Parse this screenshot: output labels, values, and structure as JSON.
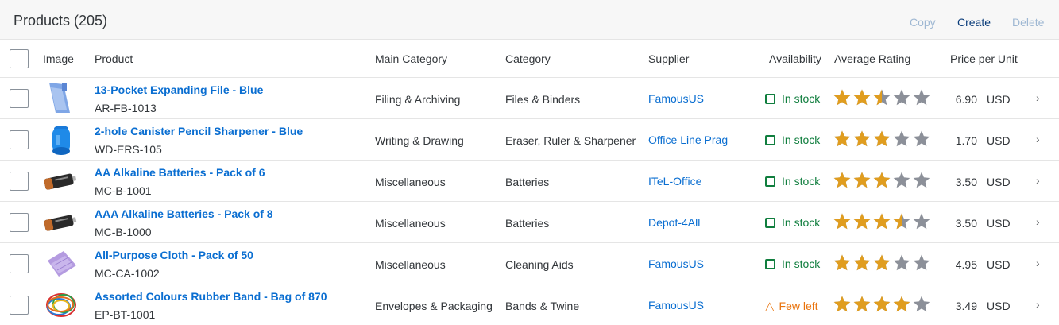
{
  "toolbar": {
    "title": "Products (205)",
    "copy_label": "Copy",
    "create_label": "Create",
    "delete_label": "Delete"
  },
  "columns": {
    "image": "Image",
    "product": "Product",
    "main_category": "Main Category",
    "category": "Category",
    "supplier": "Supplier",
    "availability": "Availability",
    "average_rating": "Average Rating",
    "price_per_unit": "Price per Unit"
  },
  "rating_colors": {
    "filled": "#e09d1f",
    "empty": "#8c9099"
  },
  "status_colors": {
    "in_stock": "#107e3e",
    "few_left": "#e9730c"
  },
  "rows": [
    {
      "name": "13-Pocket Expanding File - Blue",
      "id": "AR-FB-1013",
      "main_category": "Filing & Archiving",
      "category": "Files & Binders",
      "supplier": "FamousUS",
      "availability": "In stock",
      "status": "in_stock",
      "rating": 2.5,
      "price": "6.90",
      "currency": "USD",
      "image_icon": "blue-file-folder"
    },
    {
      "name": "2-hole Canister Pencil Sharpener - Blue",
      "id": "WD-ERS-105",
      "main_category": "Writing & Drawing",
      "category": "Eraser, Ruler & Sharpener",
      "supplier": "Office Line Prag",
      "availability": "In stock",
      "status": "in_stock",
      "rating": 3,
      "price": "1.70",
      "currency": "USD",
      "image_icon": "blue-pencil-sharpener"
    },
    {
      "name": "AA Alkaline Batteries - Pack of 6",
      "id": "MC-B-1001",
      "main_category": "Miscellaneous",
      "category": "Batteries",
      "supplier": "ITeL-Office",
      "availability": "In stock",
      "status": "in_stock",
      "rating": 3,
      "price": "3.50",
      "currency": "USD",
      "image_icon": "battery"
    },
    {
      "name": "AAA Alkaline Batteries - Pack of 8",
      "id": "MC-B-1000",
      "main_category": "Miscellaneous",
      "category": "Batteries",
      "supplier": "Depot-4All",
      "availability": "In stock",
      "status": "in_stock",
      "rating": 3.5,
      "price": "3.50",
      "currency": "USD",
      "image_icon": "battery"
    },
    {
      "name": "All-Purpose Cloth - Pack of 50",
      "id": "MC-CA-1002",
      "main_category": "Miscellaneous",
      "category": "Cleaning Aids",
      "supplier": "FamousUS",
      "availability": "In stock",
      "status": "in_stock",
      "rating": 3,
      "price": "4.95",
      "currency": "USD",
      "image_icon": "purple-cloth"
    },
    {
      "name": "Assorted Colours Rubber Band - Bag of 870",
      "id": "EP-BT-1001",
      "main_category": "Envelopes & Packaging",
      "category": "Bands & Twine",
      "supplier": "FamousUS",
      "availability": "Few left",
      "status": "few_left",
      "rating": 4,
      "price": "3.49",
      "currency": "USD",
      "image_icon": "rubber-bands"
    }
  ]
}
